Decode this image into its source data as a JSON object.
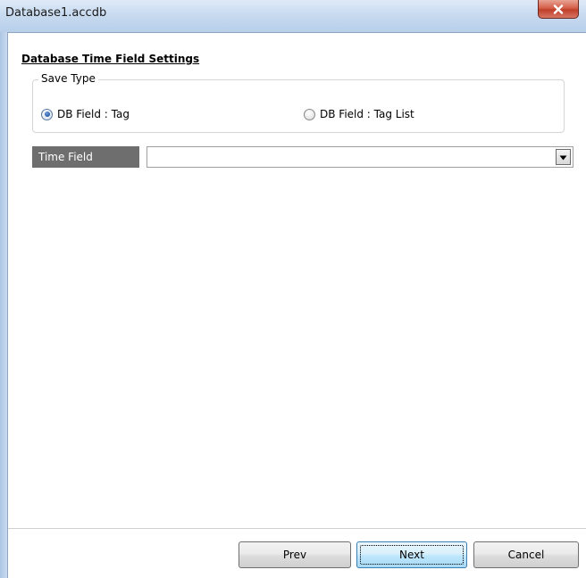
{
  "window": {
    "title": "Database1.accdb"
  },
  "section": {
    "title": "Database Time Field Settings"
  },
  "save_type": {
    "legend": "Save Type",
    "options": [
      {
        "label": "DB Field : Tag",
        "selected": true
      },
      {
        "label": "DB Field : Tag List",
        "selected": false
      }
    ]
  },
  "time_field": {
    "label": "Time Field",
    "value": ""
  },
  "buttons": {
    "prev": "Prev",
    "next": "Next",
    "cancel": "Cancel"
  },
  "icons": {
    "close": "close-icon",
    "dropdown": "chevron-down-icon"
  },
  "colors": {
    "titlebar": "#c6d9ef",
    "close_button": "#c9503a",
    "field_label_bg": "#6e6e6e",
    "default_button": "#bee6fd"
  }
}
